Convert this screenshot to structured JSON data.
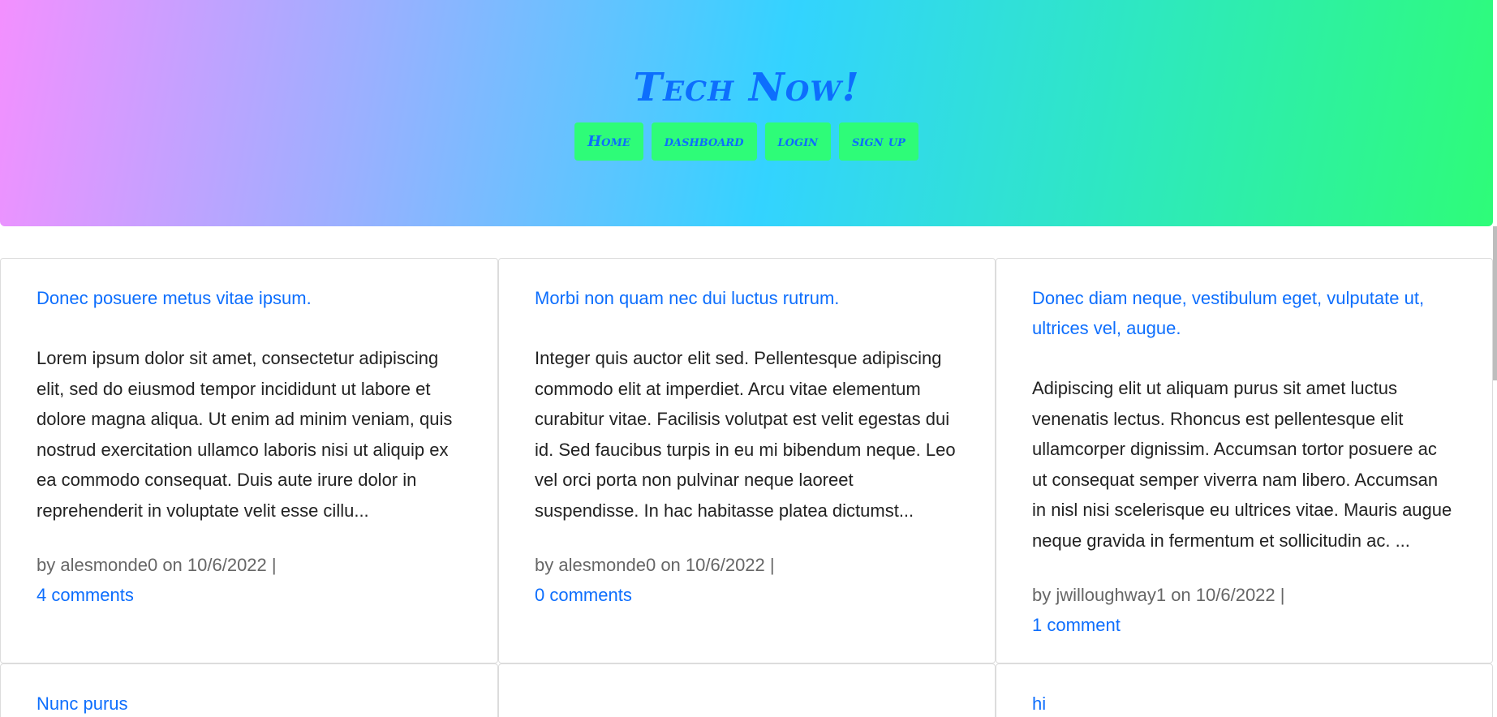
{
  "site": {
    "title": "Tech Now!",
    "nav": [
      "Home",
      "dashboard",
      "login",
      "sign up"
    ]
  },
  "posts": [
    {
      "title": "Donec posuere metus vitae ipsum.",
      "body": "Lorem ipsum dolor sit amet, consectetur adipiscing elit, sed do eiusmod tempor incididunt ut labore et dolore magna aliqua. Ut enim ad minim veniam, quis nostrud exercitation ullamco laboris nisi ut aliquip ex ea commodo consequat. Duis aute irure dolor in reprehenderit in voluptate velit esse cillu...",
      "meta": "by alesmonde0 on 10/6/2022 |",
      "comments": "4 comments"
    },
    {
      "title": "Morbi non quam nec dui luctus rutrum.",
      "body": "Integer quis auctor elit sed. Pellentesque adipiscing commodo elit at imperdiet. Arcu vitae elementum curabitur vitae. Facilisis volutpat est velit egestas dui id. Sed faucibus turpis in eu mi bibendum neque. Leo vel orci porta non pulvinar neque laoreet suspendisse. In hac habitasse platea dictumst...",
      "meta": "by alesmonde0 on 10/6/2022 |",
      "comments": "0 comments"
    },
    {
      "title": "Donec diam neque, vestibulum eget, vulputate ut, ultrices vel, augue.",
      "body": "Adipiscing elit ut aliquam purus sit amet luctus venenatis lectus. Rhoncus est pellentesque elit ullamcorper dignissim. Accumsan tortor posuere ac ut consequat semper viverra nam libero. Accumsan in nisl nisi scelerisque eu ultrices vitae. Mauris augue neque gravida in fermentum et sollicitudin ac. ...",
      "meta": "by jwilloughway1 on 10/6/2022 |",
      "comments": "1 comment"
    },
    {
      "title": "Nunc purus"
    },
    {
      "title": ""
    },
    {
      "title": "hi"
    }
  ],
  "colors": {
    "accent": "#0d6efd",
    "nav_button": "#2efc78",
    "gradient": [
      "#f390ff",
      "#9ab0ff",
      "#33d3ff",
      "#2ee8c0",
      "#2efc78"
    ]
  }
}
